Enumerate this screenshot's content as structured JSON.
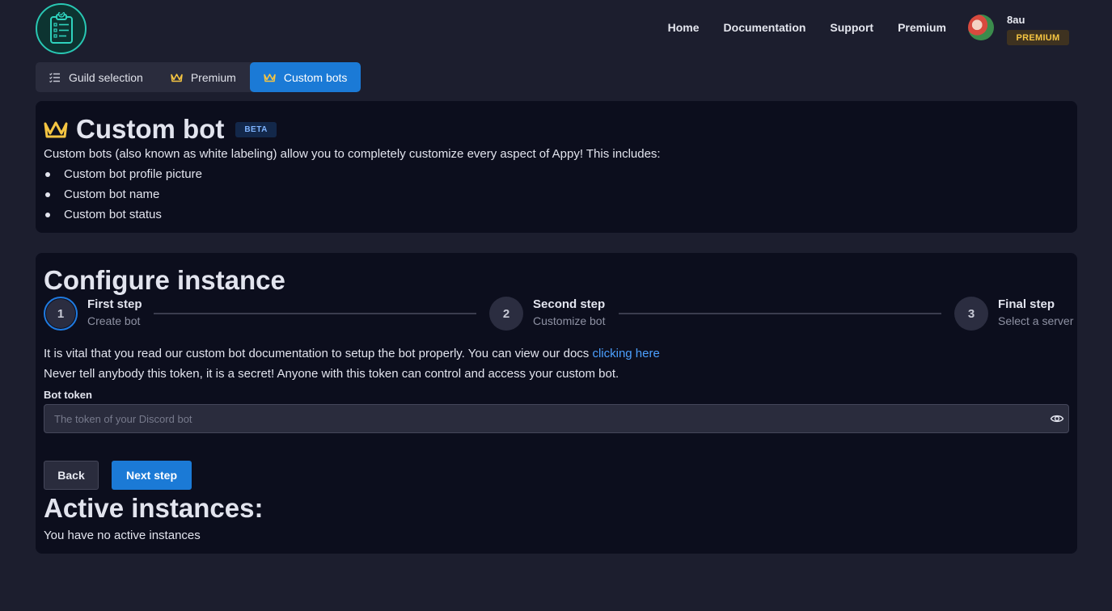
{
  "header": {
    "logo_icon": "clipboard-checklist-icon",
    "nav": [
      "Home",
      "Documentation",
      "Support",
      "Premium"
    ],
    "user": {
      "name": "8au",
      "badge": "PREMIUM"
    }
  },
  "tabs": [
    {
      "label": "Guild selection",
      "icon": "list-icon",
      "active": false
    },
    {
      "label": "Premium",
      "icon": "crown-icon",
      "active": false
    },
    {
      "label": "Custom bots",
      "icon": "crown-icon",
      "active": true
    }
  ],
  "intro_card": {
    "title": "Custom bot",
    "badge": "BETA",
    "description": "Custom bots (also known as white labeling) allow you to completely customize every aspect of Appy! This includes:",
    "features": [
      "Custom bot profile picture",
      "Custom bot name",
      "Custom bot status"
    ]
  },
  "configure": {
    "title": "Configure instance",
    "steps": [
      {
        "number": "1",
        "title": "First step",
        "subtitle": "Create bot",
        "active": true
      },
      {
        "number": "2",
        "title": "Second step",
        "subtitle": "Customize bot",
        "active": false
      },
      {
        "number": "3",
        "title": "Final step",
        "subtitle": "Select a server",
        "active": false
      }
    ],
    "doc_text": "It is vital that you read our custom bot documentation to setup the bot properly. You can view our docs ",
    "doc_link": "clicking here",
    "warning": "Never tell anybody this token, it is a secret! Anyone with this token can control and access your custom bot.",
    "token_label": "Bot token",
    "token_placeholder": "The token of your Discord bot",
    "token_value": "",
    "back_label": "Back",
    "next_label": "Next step"
  },
  "active_instances": {
    "title": "Active instances:",
    "empty_text": "You have no active instances"
  },
  "colors": {
    "accent": "#1b7ad6",
    "premium_gold": "#f5c542",
    "link": "#4ca0ff",
    "card_bg": "#0c0e1d",
    "page_bg": "#1c1e2e"
  }
}
